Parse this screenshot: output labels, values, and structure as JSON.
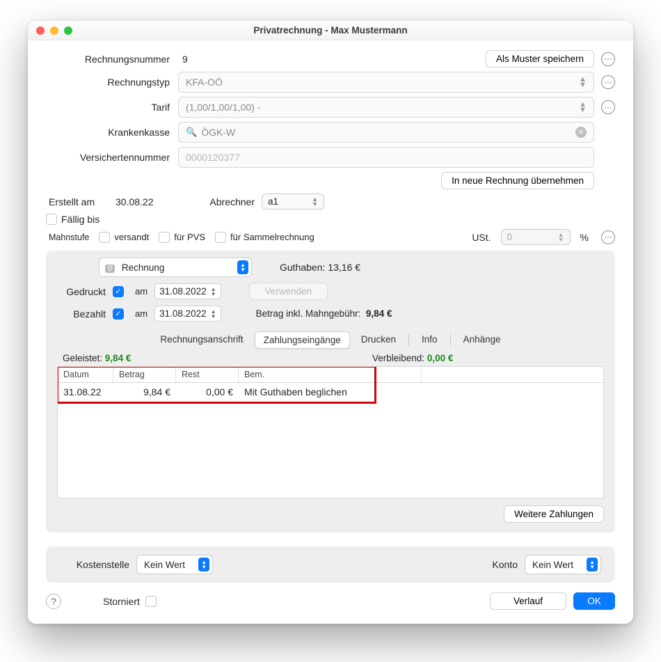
{
  "window": {
    "title": "Privatrechnung - Max Mustermann"
  },
  "labels": {
    "rechnungsnummer": "Rechnungsnummer",
    "rechnungstyp": "Rechnungstyp",
    "tarif": "Tarif",
    "krankenkasse": "Krankenkasse",
    "versichertennr": "Versichertennummer",
    "erstellt_am": "Erstellt am",
    "abrechner": "Abrechner",
    "faellig_bis": "Fällig bis",
    "mahnstufe": "Mahnstufe",
    "versandt": "versandt",
    "fuer_pvs": "für PVS",
    "fuer_sammel": "für Sammelrechnung",
    "ust": "USt.",
    "gedruckt": "Gedruckt",
    "bezahlt": "Bezahlt",
    "am": "am",
    "betrag_mahn": "Betrag inkl. Mahngebühr:",
    "guthaben": "Guthaben:",
    "verwenden": "Verwenden",
    "als_muster": "Als Muster speichern",
    "in_neue": "In neue Rechnung übernehmen",
    "weitere_zahlungen": "Weitere Zahlungen",
    "kostenstelle": "Kostenstelle",
    "konto": "Konto",
    "storniert": "Storniert",
    "verlauf": "Verlauf",
    "ok": "OK",
    "geleistet": "Geleistet:",
    "verbleibend": "Verbleibend:",
    "percent": "%"
  },
  "values": {
    "rechnungsnummer": "9",
    "rechnungstyp": "KFA-OÖ",
    "tarif": "(1,00/1,00/1,00) -",
    "krankenkasse": "ÖGK-W",
    "versichertennr_placeholder": "0000120377",
    "erstellt_am": "30.08.22",
    "abrechner": "a1",
    "ust": "0",
    "stufe_badge": "0",
    "stufe_label": "Rechnung",
    "gedruckt_date": "31.08.2022",
    "bezahlt_date": "31.08.2022",
    "guthaben_amount": "13,16 €",
    "betrag_mahn_amount": "9,84 €",
    "geleistet_amount": "9,84 €",
    "verbleibend_amount": "0,00 €",
    "kostenstelle": "Kein Wert",
    "konto": "Kein Wert"
  },
  "tabs": {
    "t1": "Rechnungsanschrift",
    "t2": "Zahlungseingänge",
    "t3": "Drucken",
    "t4": "Info",
    "t5": "Anhänge",
    "active": "t2"
  },
  "table": {
    "headers": {
      "c1": "Datum",
      "c2": "Betrag",
      "c3": "Rest",
      "c4": "Bem."
    },
    "rows": [
      {
        "c1": "31.08.22",
        "c2": "9,84 €",
        "c3": "0,00 €",
        "c4": "Mit Guthaben beglichen"
      }
    ]
  }
}
